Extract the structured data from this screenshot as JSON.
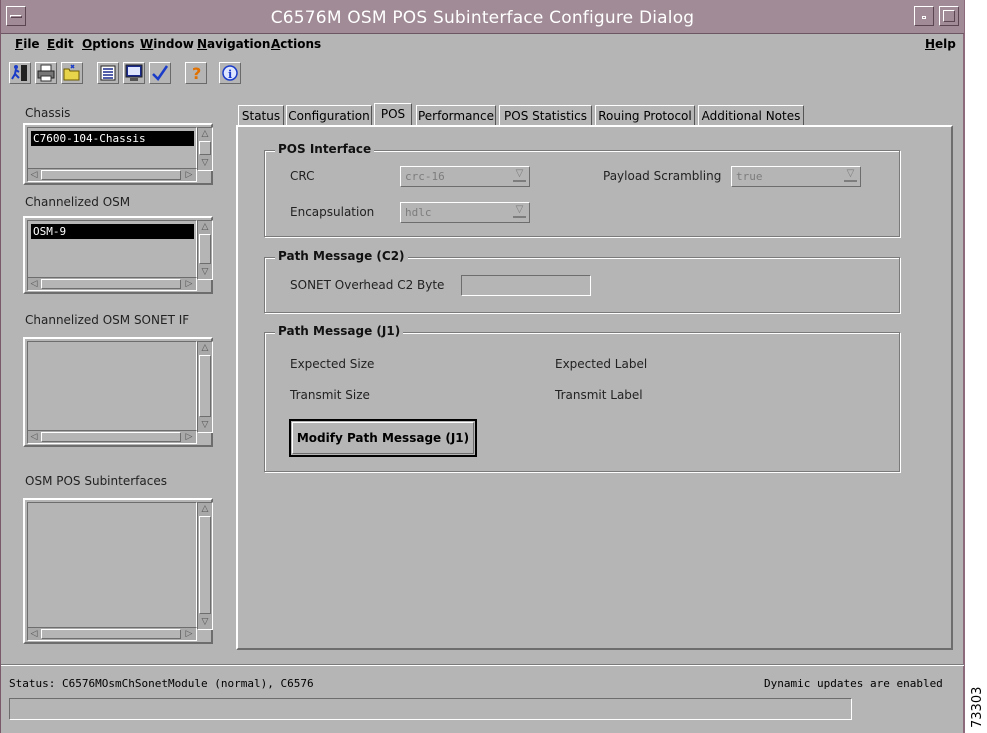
{
  "window": {
    "title": "C6576M OSM POS Subinterface Configure Dialog"
  },
  "menubar": {
    "file": "File",
    "edit": "Edit",
    "options": "Options",
    "window": "Window",
    "navigation": "Navigation",
    "actions": "Actions",
    "help": "Help"
  },
  "toolbar": {
    "icons": [
      "exit-icon",
      "print-icon",
      "open-folder-icon",
      "list-icon",
      "monitor-icon",
      "checkmark-icon",
      "help-question-icon",
      "info-icon"
    ]
  },
  "sidebar": {
    "chassis_label": "Chassis",
    "chassis_items": [
      "C7600-104-Chassis"
    ],
    "osm_label": "Channelized OSM",
    "osm_items": [
      "OSM-9"
    ],
    "sonet_label": "Channelized OSM SONET IF",
    "subif_label": "OSM POS Subinterfaces"
  },
  "tabs": [
    "Status",
    "Configuration",
    "POS",
    "Performance",
    "POS Statistics",
    "Rouing Protocol",
    "Additional Notes"
  ],
  "active_tab": "POS",
  "pos_interface": {
    "title": "POS Interface",
    "crc_label": "CRC",
    "crc_value": "crc-16",
    "scrambling_label": "Payload Scrambling",
    "scrambling_value": "true",
    "encap_label": "Encapsulation",
    "encap_value": "hdlc"
  },
  "path_c2": {
    "title": "Path Message (C2)",
    "byte_label": "SONET Overhead C2 Byte",
    "byte_value": ""
  },
  "path_j1": {
    "title": "Path Message (J1)",
    "expected_size": "Expected Size",
    "expected_label": "Expected Label",
    "transmit_size": "Transmit Size",
    "transmit_label": "Transmit Label",
    "modify_button": "Modify Path Message (J1)"
  },
  "status": {
    "text": "Status: C6576MOsmChSonetModule (normal), C6576",
    "dynamic": "Dynamic updates are enabled"
  },
  "figure_id": "73303",
  "colors": {
    "titlebar": "#a08b96",
    "background": "#b5b5b5",
    "selection": "#000000"
  }
}
